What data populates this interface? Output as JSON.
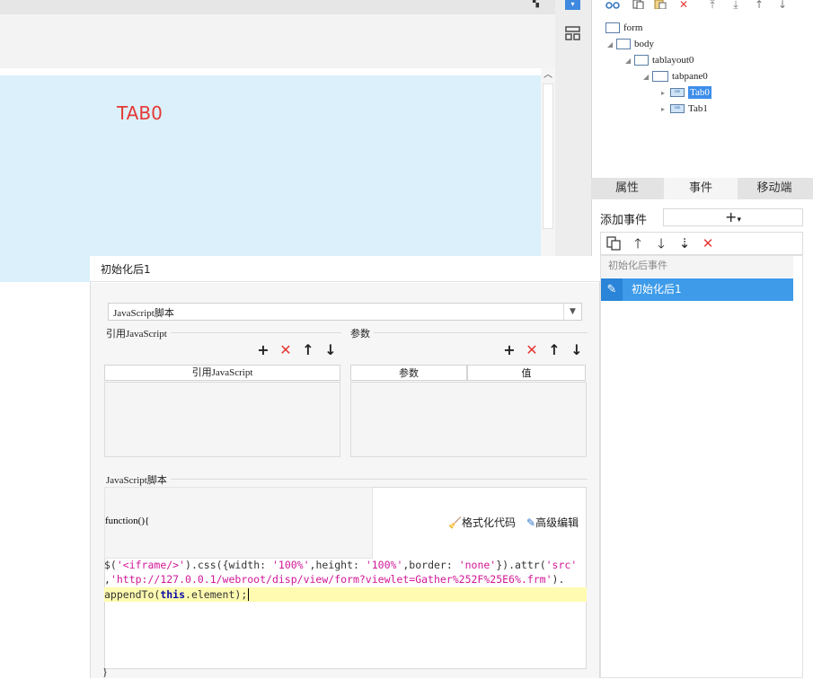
{
  "canvas": {
    "tab_title": "TAB0",
    "top_icon": "connector-icon"
  },
  "tree": {
    "toolbar_icons": [
      "cut-icon",
      "copy-icon",
      "paste-icon",
      "delete-icon",
      "move-top-icon",
      "move-bottom-icon",
      "move-up-icon",
      "move-down-icon"
    ],
    "nodes": [
      {
        "label": "form"
      },
      {
        "label": "body"
      },
      {
        "label": "tablayout0"
      },
      {
        "label": "tabpane0"
      },
      {
        "label": "Tab0"
      },
      {
        "label": "Tab1"
      }
    ],
    "tab_icon_text": "tab"
  },
  "right_tabs": [
    "属性",
    "事件",
    "移动端"
  ],
  "events": {
    "add_label": "添加事件",
    "add_button": "+",
    "add_dropdown": "▾",
    "group_label": "初始化后事件",
    "items": [
      {
        "label": "初始化后1"
      }
    ]
  },
  "dialog": {
    "title": "初始化后1",
    "type_value": "JavaScript脚本",
    "ref_js": {
      "section_label": "引用JavaScript",
      "column_header": "引用JavaScript"
    },
    "params": {
      "section_label": "参数",
      "col_param": "参数",
      "col_value": "值"
    },
    "script": {
      "section_label": "JavaScript脚本",
      "func_header": "function(){",
      "format_label": "格式化代码",
      "advanced_label": "高级编辑",
      "line1_prefix": "$(",
      "line1_s1": "'<iframe/>'",
      "line1_a": ").css({width: ",
      "line1_s2": "'100%'",
      "line1_b": ",height: ",
      "line1_s3": "'100%'",
      "line1_c": ",border: ",
      "line1_s4": "'none'",
      "line1_d": "}).attr(",
      "line1_s5": "'src'",
      "line2_a": ",",
      "line2_s": "'http://127.0.0.1/webroot/disp/view/form?viewlet=Gather%252F%25E6%.frm'",
      "line2_b": ").",
      "line3_a": "appendTo(",
      "line3_kw": "this",
      "line3_b": ".element);",
      "closing": "}"
    }
  }
}
